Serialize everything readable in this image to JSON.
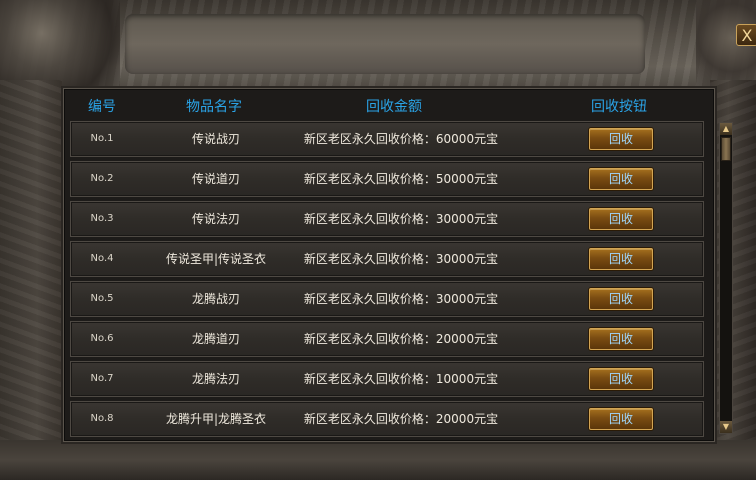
{
  "header": {
    "col_no": "编号",
    "col_name": "物品名字",
    "col_amount": "回收金额",
    "col_button": "回收按钮"
  },
  "close_label": "X",
  "rows": [
    {
      "no": "No.1",
      "name": "传说战刃",
      "price": "新区老区永久回收价格：60000元宝",
      "button": "回收"
    },
    {
      "no": "No.2",
      "name": "传说道刃",
      "price": "新区老区永久回收价格：50000元宝",
      "button": "回收"
    },
    {
      "no": "No.3",
      "name": "传说法刃",
      "price": "新区老区永久回收价格：30000元宝",
      "button": "回收"
    },
    {
      "no": "No.4",
      "name": "传说圣甲|传说圣衣",
      "price": "新区老区永久回收价格：30000元宝",
      "button": "回收"
    },
    {
      "no": "No.5",
      "name": "龙腾战刃",
      "price": "新区老区永久回收价格：30000元宝",
      "button": "回收"
    },
    {
      "no": "No.6",
      "name": "龙腾道刃",
      "price": "新区老区永久回收价格：20000元宝",
      "button": "回收"
    },
    {
      "no": "No.7",
      "name": "龙腾法刃",
      "price": "新区老区永久回收价格：10000元宝",
      "button": "回收"
    },
    {
      "no": "No.8",
      "name": "龙腾升甲|龙腾圣衣",
      "price": "新区老区永久回收价格：20000元宝",
      "button": "回收"
    }
  ],
  "icons": {
    "close": "close-icon",
    "scroll_up": "chevron-up-icon",
    "scroll_down": "chevron-down-icon"
  }
}
